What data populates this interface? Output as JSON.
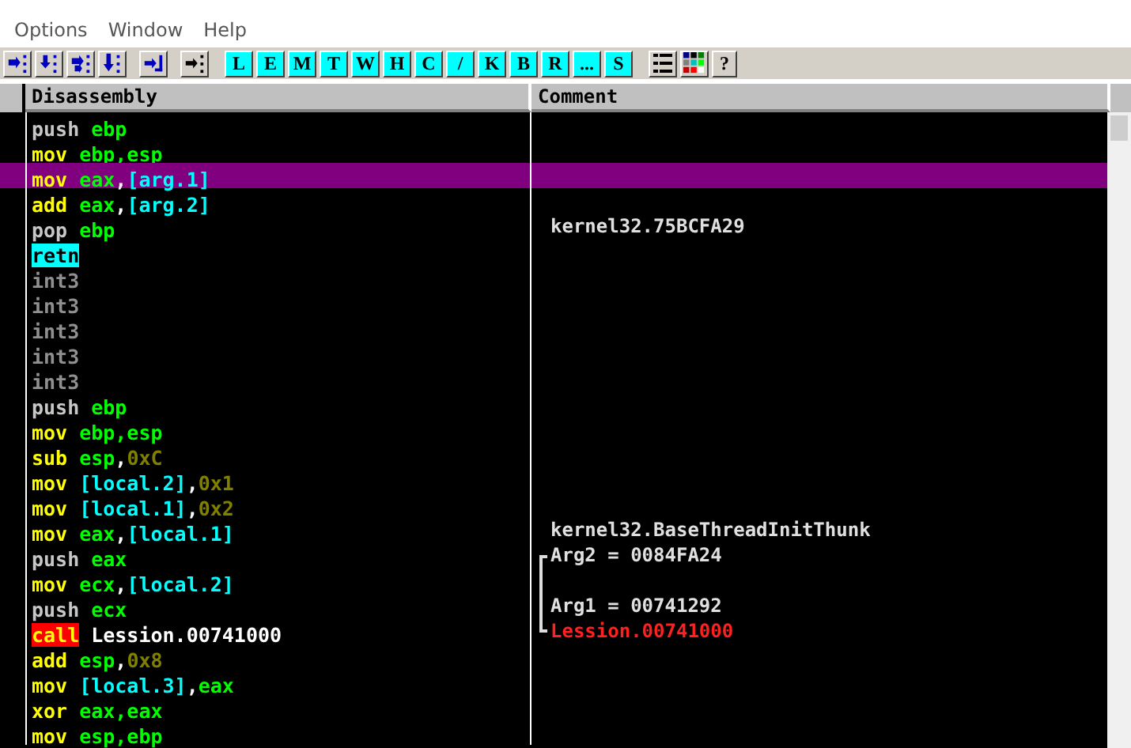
{
  "menu": [
    {
      "label": "Options"
    },
    {
      "label": "Window"
    },
    {
      "label": "Help"
    }
  ],
  "toolbar": {
    "arrows": [
      {
        "kind": "step-into"
      },
      {
        "kind": "step-over"
      },
      {
        "kind": "trace-into"
      },
      {
        "kind": "trace-over"
      },
      {
        "kind": "till-return"
      },
      {
        "kind": "goto"
      }
    ],
    "letters": [
      "L",
      "E",
      "M",
      "T",
      "W",
      "H",
      "C",
      "/",
      "K",
      "B",
      "R",
      "...",
      "S"
    ],
    "tools": [
      {
        "kind": "list"
      },
      {
        "kind": "colors"
      },
      {
        "kind": "help",
        "label": "?"
      }
    ]
  },
  "columns": [
    {
      "label": "Disassembly"
    },
    {
      "label": "Comment"
    }
  ],
  "rows": [
    {
      "selected": false,
      "mnemonic": {
        "text": "push",
        "kind": "stack"
      },
      "operands": [
        {
          "text": "ebp",
          "kind": "reg"
        }
      ]
    },
    {
      "selected": false,
      "mnemonic": {
        "text": "mov",
        "kind": "op"
      },
      "operands": [
        {
          "text": "ebp,esp",
          "kind": "reg"
        }
      ]
    },
    {
      "selected": true,
      "mnemonic": {
        "text": "mov",
        "kind": "op"
      },
      "operands": [
        {
          "text": "eax",
          "kind": "reg"
        },
        {
          "text": ",",
          "kind": "punct"
        },
        {
          "text": "[arg.1]",
          "kind": "mem"
        }
      ]
    },
    {
      "selected": false,
      "mnemonic": {
        "text": "add",
        "kind": "op"
      },
      "operands": [
        {
          "text": "eax",
          "kind": "reg"
        },
        {
          "text": ",",
          "kind": "punct"
        },
        {
          "text": "[arg.2]",
          "kind": "mem"
        }
      ]
    },
    {
      "selected": false,
      "mnemonic": {
        "text": "pop",
        "kind": "stack"
      },
      "operands": [
        {
          "text": "ebp",
          "kind": "reg"
        }
      ],
      "comment": {
        "text": "kernel32.75BCFA29",
        "kind": "plain"
      }
    },
    {
      "selected": false,
      "mnemonic": {
        "text": "retn",
        "kind": "ret"
      }
    },
    {
      "selected": false,
      "mnemonic": {
        "text": "int3",
        "kind": "pad"
      }
    },
    {
      "selected": false,
      "mnemonic": {
        "text": "int3",
        "kind": "pad"
      }
    },
    {
      "selected": false,
      "mnemonic": {
        "text": "int3",
        "kind": "pad"
      }
    },
    {
      "selected": false,
      "mnemonic": {
        "text": "int3",
        "kind": "pad"
      }
    },
    {
      "selected": false,
      "mnemonic": {
        "text": "int3",
        "kind": "pad"
      }
    },
    {
      "selected": false,
      "mnemonic": {
        "text": "push",
        "kind": "stack"
      },
      "operands": [
        {
          "text": "ebp",
          "kind": "reg"
        }
      ]
    },
    {
      "selected": false,
      "mnemonic": {
        "text": "mov",
        "kind": "op"
      },
      "operands": [
        {
          "text": "ebp,esp",
          "kind": "reg"
        }
      ]
    },
    {
      "selected": false,
      "mnemonic": {
        "text": "sub",
        "kind": "op"
      },
      "operands": [
        {
          "text": "esp",
          "kind": "reg"
        },
        {
          "text": ",",
          "kind": "punct"
        },
        {
          "text": "0xC",
          "kind": "const"
        }
      ]
    },
    {
      "selected": false,
      "mnemonic": {
        "text": "mov",
        "kind": "op"
      },
      "operands": [
        {
          "text": "[local.2]",
          "kind": "mem"
        },
        {
          "text": ",",
          "kind": "punct"
        },
        {
          "text": "0x1",
          "kind": "const"
        }
      ]
    },
    {
      "selected": false,
      "mnemonic": {
        "text": "mov",
        "kind": "op"
      },
      "operands": [
        {
          "text": "[local.1]",
          "kind": "mem"
        },
        {
          "text": ",",
          "kind": "punct"
        },
        {
          "text": "0x2",
          "kind": "const"
        }
      ]
    },
    {
      "selected": false,
      "mnemonic": {
        "text": "mov",
        "kind": "op"
      },
      "operands": [
        {
          "text": "eax",
          "kind": "reg"
        },
        {
          "text": ",",
          "kind": "punct"
        },
        {
          "text": "[local.1]",
          "kind": "mem"
        }
      ],
      "comment": {
        "text": "kernel32.BaseThreadInitThunk",
        "kind": "plain"
      }
    },
    {
      "selected": false,
      "mnemonic": {
        "text": "push",
        "kind": "stack"
      },
      "operands": [
        {
          "text": "eax",
          "kind": "reg"
        }
      ],
      "comment": {
        "text": "Arg2 = 0084FA24",
        "kind": "plain",
        "bracket": {
          "kind": "start"
        }
      }
    },
    {
      "selected": false,
      "mnemonic": {
        "text": "mov",
        "kind": "op"
      },
      "operands": [
        {
          "text": "ecx",
          "kind": "reg"
        },
        {
          "text": ",",
          "kind": "punct"
        },
        {
          "text": "[local.2]",
          "kind": "mem"
        }
      ],
      "comment": {
        "bracket": {
          "kind": "mid"
        }
      }
    },
    {
      "selected": false,
      "mnemonic": {
        "text": "push",
        "kind": "stack"
      },
      "operands": [
        {
          "text": "ecx",
          "kind": "reg"
        }
      ],
      "comment": {
        "text": "Arg1 = 00741292",
        "kind": "plain",
        "bracket": {
          "kind": "mid"
        }
      }
    },
    {
      "selected": false,
      "mnemonic": {
        "text": "call",
        "kind": "call"
      },
      "operands": [
        {
          "text": "Lession.00741000",
          "kind": "label"
        }
      ],
      "comment": {
        "text": "Lession.00741000",
        "kind": "call",
        "bracket": {
          "kind": "end"
        }
      }
    },
    {
      "selected": false,
      "mnemonic": {
        "text": "add",
        "kind": "op"
      },
      "operands": [
        {
          "text": "esp",
          "kind": "reg"
        },
        {
          "text": ",",
          "kind": "punct"
        },
        {
          "text": "0x8",
          "kind": "const"
        }
      ]
    },
    {
      "selected": false,
      "mnemonic": {
        "text": "mov",
        "kind": "op"
      },
      "operands": [
        {
          "text": "[local.3]",
          "kind": "mem"
        },
        {
          "text": ",",
          "kind": "punct"
        },
        {
          "text": "eax",
          "kind": "reg"
        }
      ]
    },
    {
      "selected": false,
      "mnemonic": {
        "text": "xor",
        "kind": "op"
      },
      "operands": [
        {
          "text": "eax,eax",
          "kind": "reg"
        }
      ]
    },
    {
      "selected": false,
      "mnemonic": {
        "text": "mov",
        "kind": "op"
      },
      "operands": [
        {
          "text": "esp,ebp",
          "kind": "reg"
        }
      ]
    }
  ]
}
